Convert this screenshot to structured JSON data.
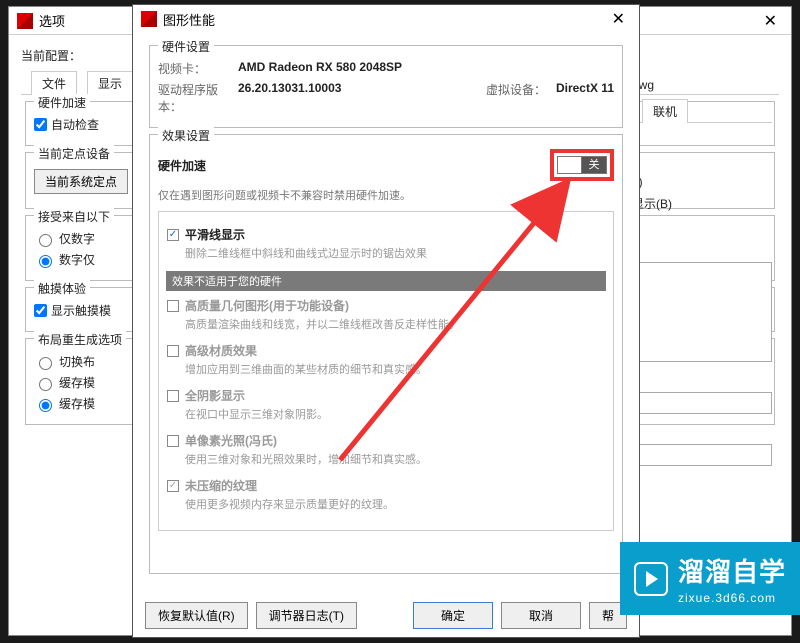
{
  "bgWindow": {
    "title": "选项",
    "currentConfigLabel": "当前配置：",
    "tabs": [
      "文件",
      "显示",
      "联机"
    ],
    "hwAccelGroup": {
      "legend": "硬件加速",
      "autoCheck": "自动检查"
    },
    "pointDeviceGroup": {
      "legend": "当前定点设备",
      "button": "当前系统定点"
    },
    "acceptFromGroup": {
      "legend": "接受来自以下",
      "opt1": "仅数字",
      "opt2": "数字仅"
    },
    "touchGroup": {
      "legend": "触摸体验",
      "showTouch": "显示触摸模"
    },
    "layoutRegenGroup": {
      "legend": "布局重生成选项",
      "opt1": "切换布",
      "opt2": "缓存模",
      "opt3": "缓存模"
    },
    "rightFileExt": "dwg",
    "rightL": "L)",
    "rightShowB": "显示(B)"
  },
  "dlg": {
    "title": "图形性能",
    "hwSection": {
      "legend": "硬件设置",
      "videoCardLabel": "视频卡：",
      "videoCardValue": "AMD Radeon RX 580 2048SP",
      "driverLabel": "驱动程序版本：",
      "driverValue": "26.20.13031.10003",
      "virtLabel": "虚拟设备：",
      "virtValue": "DirectX 11"
    },
    "effectSection": {
      "legend": "效果设置",
      "accelLabel": "硬件加速",
      "accelState": "关",
      "accelHint": "仅在遇到图形问题或视频卡不兼容时禁用硬件加速。",
      "smoothLine": {
        "title": "平滑线显示",
        "desc": "删除二维线框中斜线和曲线式边显示时的锯齿效果"
      },
      "stripe": "效果不适用于您的硬件",
      "highGeom": {
        "title": "高质量几何图形(用于功能设备)",
        "desc": "高质量渲染曲线和线宽，并以二维线框改善反走样性能。"
      },
      "advMat": {
        "title": "高级材质效果",
        "desc": "增加应用到三维曲面的某些材质的细节和真实感。"
      },
      "shadow": {
        "title": "全阴影显示",
        "desc": "在视口中显示三维对象阴影。"
      },
      "pixelLight": {
        "title": "单像素光照(冯氏)",
        "desc": "使用三维对象和光照效果时，增加细节和真实感。"
      },
      "texture": {
        "title": "未压缩的纹理",
        "desc": "使用更多视频内存来显示质量更好的纹理。"
      }
    },
    "footer": {
      "restore": "恢复默认值(R)",
      "tuner": "调节器日志(T)",
      "ok": "确定",
      "cancel": "取消",
      "help": "帮"
    }
  },
  "watermark": {
    "big": "溜溜自学",
    "sub": "zixue.3d66.com"
  }
}
